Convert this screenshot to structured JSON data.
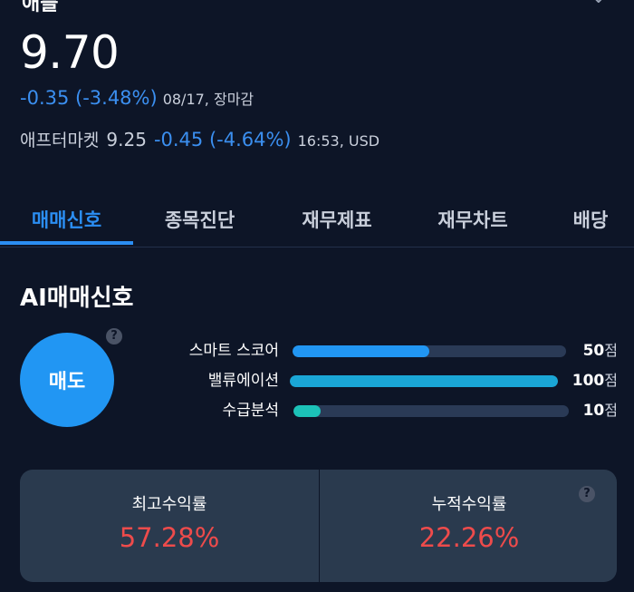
{
  "header": {
    "title": "애플",
    "price": "9.70",
    "change": "-0.35 (-3.48%)",
    "change_meta": "08/17, 장마감",
    "after_market_label": "애프터마켓",
    "after_market_price": "9.25",
    "after_market_change": "-0.45 (-4.64%)",
    "after_market_meta": "16:53, USD"
  },
  "tabs": [
    {
      "label": "매매신호",
      "active": true
    },
    {
      "label": "종목진단",
      "active": false
    },
    {
      "label": "재무제표",
      "active": false
    },
    {
      "label": "재무차트",
      "active": false
    },
    {
      "label": "배당",
      "active": false
    }
  ],
  "ai_signal": {
    "title": "AI매매신호",
    "signal": "매도",
    "help": "?",
    "scores": [
      {
        "label": "스마트 스코어",
        "value": "50",
        "unit": "점",
        "fraction": 0.5,
        "color": "#2196f3"
      },
      {
        "label": "밸류에이션",
        "value": "100",
        "unit": "점",
        "fraction": 1.0,
        "color": "#1aa6d6"
      },
      {
        "label": "수급분석",
        "value": "10",
        "unit": "점",
        "fraction": 0.1,
        "color": "#1cc2b8"
      }
    ]
  },
  "returns": {
    "help": "?",
    "max_label": "최고수익률",
    "max_value": "57.28%",
    "cum_label": "누적수익률",
    "cum_value": "22.26%"
  },
  "colors": {
    "background": "#0d1527",
    "accent_blue": "#2b8ef3",
    "down_blue": "#3b8ff0",
    "return_red": "#ee4b4b"
  }
}
